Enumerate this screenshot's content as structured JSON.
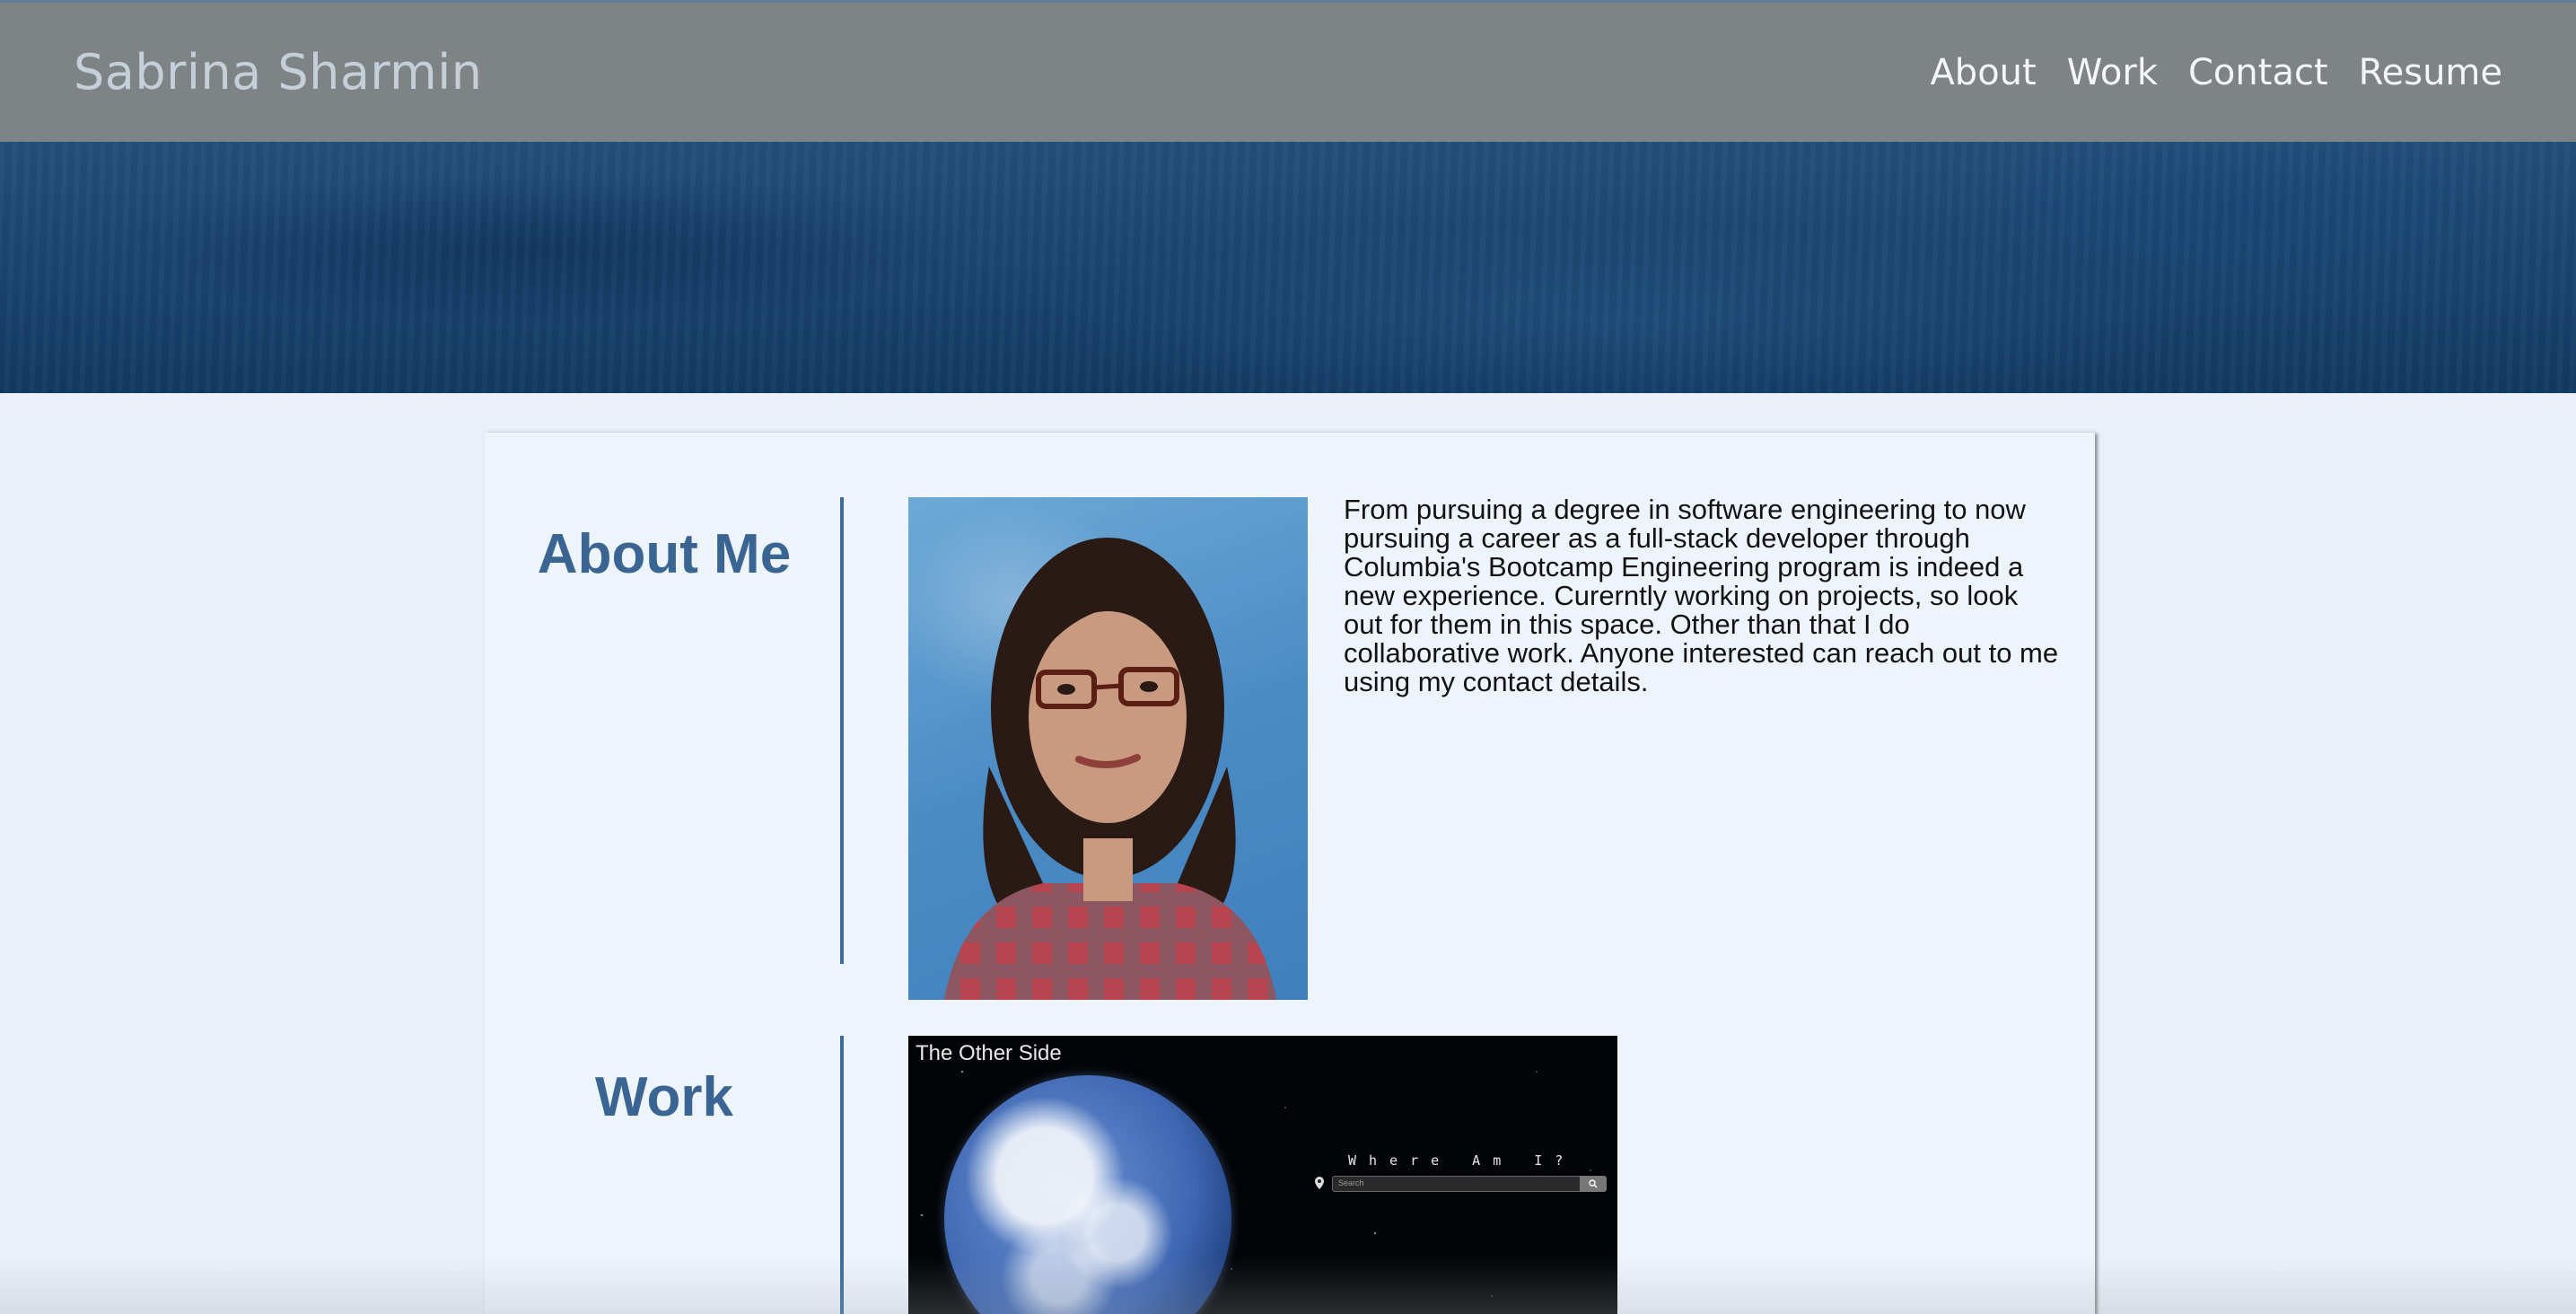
{
  "nav": {
    "brand": "Sabrina Sharmin",
    "links": [
      "About",
      "Work",
      "Contact",
      "Resume"
    ]
  },
  "about": {
    "title": "About Me",
    "photo_icon": "profile-photo",
    "bio": "From pursuing a degree in software engineering to now pursuing a career as a full-stack developer through Columbia's Bootcamp Engineering program is indeed a new experience. Curerntly working on projects, so look out for them in this space. Other than that I do collaborative work. Anyone interested can reach out to me using my contact details."
  },
  "work": {
    "title": "Work",
    "project": {
      "title": "The Other Side",
      "heading": "Where Am I?",
      "search_placeholder": "Search"
    }
  },
  "colors": {
    "navbar": "#7e8386",
    "heading_blue": "#3a6593",
    "card_bg": "#edf4fc"
  }
}
